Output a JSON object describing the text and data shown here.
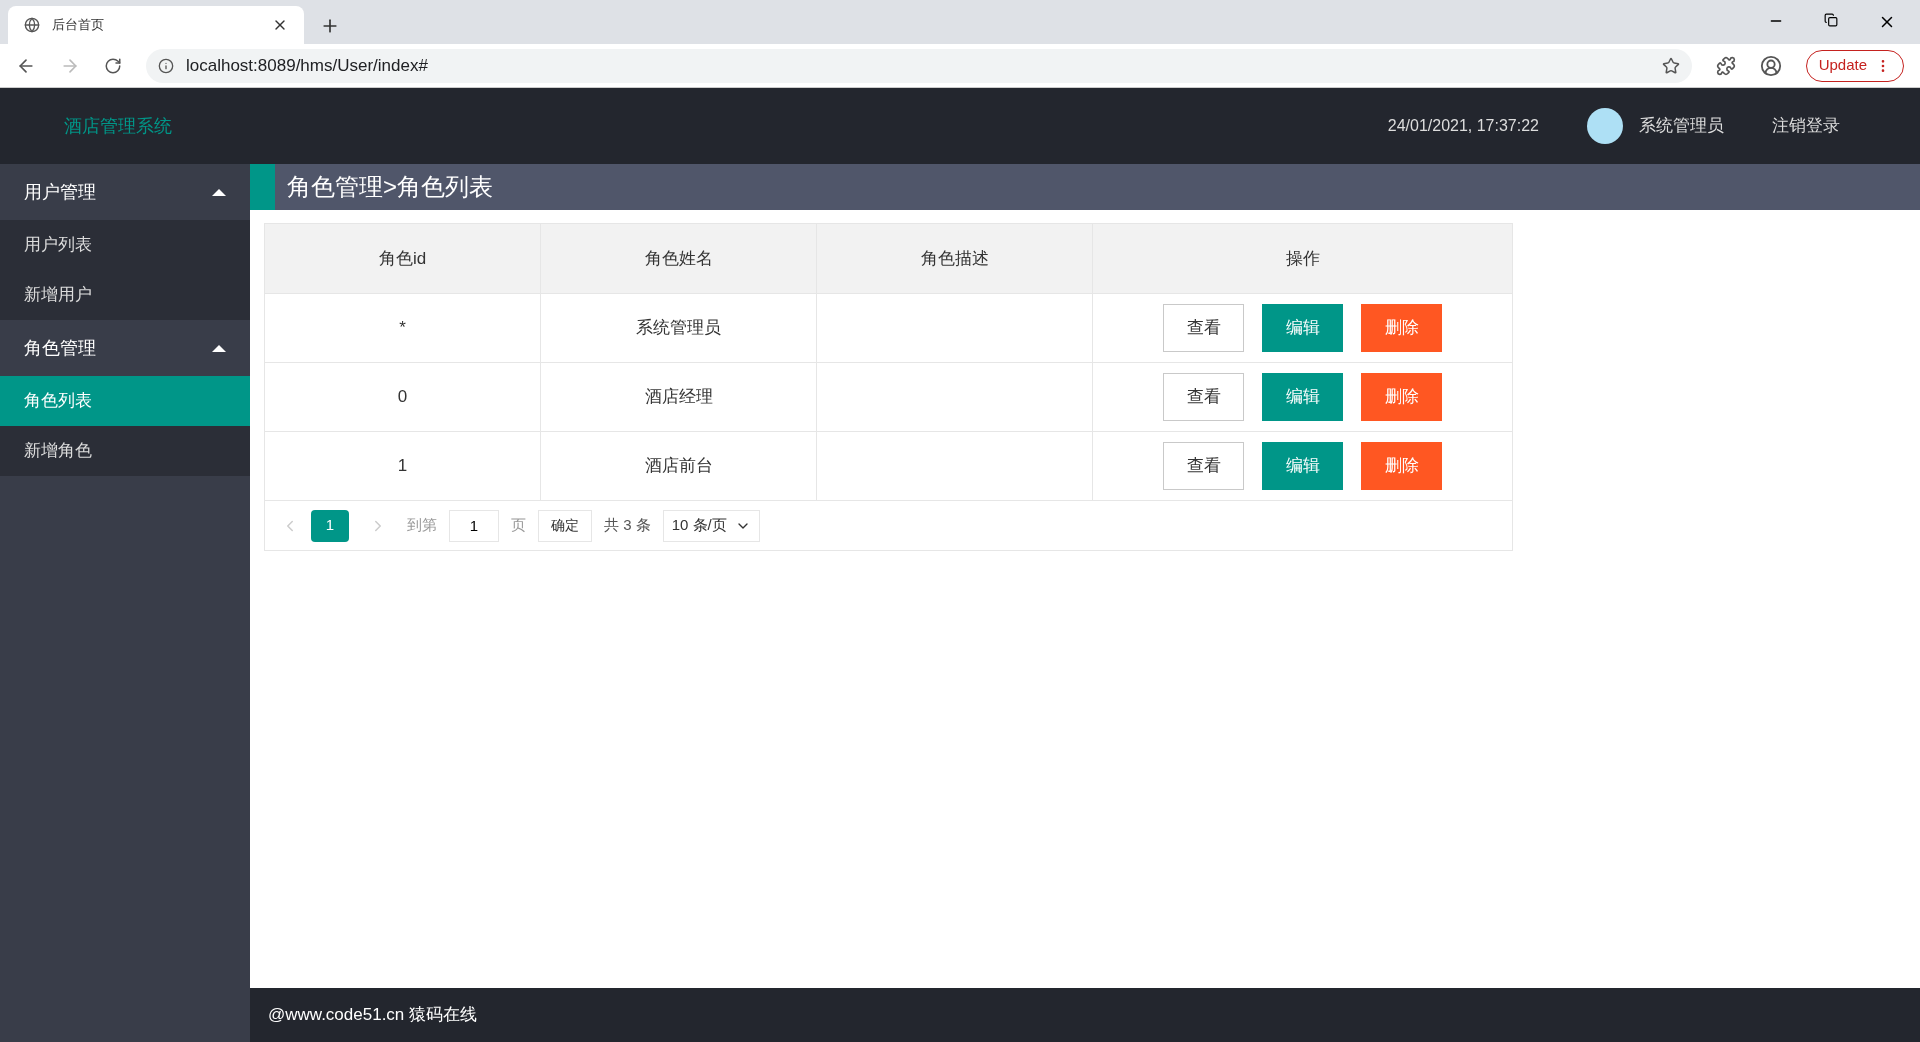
{
  "browser": {
    "tab_title": "后台首页",
    "url": "localhost:8089/hms/User/index#",
    "update_button": "Update"
  },
  "header": {
    "title": "酒店管理系统",
    "datetime": "24/01/2021, 17:37:22",
    "username": "系统管理员",
    "logout": "注销登录"
  },
  "sidebar": {
    "groups": [
      {
        "label": "用户管理",
        "expanded": true,
        "items": [
          {
            "label": "用户列表",
            "selected": false
          },
          {
            "label": "新增用户",
            "selected": false
          }
        ]
      },
      {
        "label": "角色管理",
        "expanded": true,
        "items": [
          {
            "label": "角色列表",
            "selected": true
          },
          {
            "label": "新增角色",
            "selected": false
          }
        ]
      }
    ]
  },
  "breadcrumb": "角色管理>角色列表",
  "table": {
    "columns": [
      "角色id",
      "角色姓名",
      "角色描述",
      "操作"
    ],
    "rows": [
      {
        "cells": [
          "*",
          "系统管理员",
          ""
        ],
        "actions": [
          {
            "label": "查看",
            "kind": "view"
          },
          {
            "label": "编辑",
            "kind": "edit"
          },
          {
            "label": "删除",
            "kind": "delete"
          }
        ]
      },
      {
        "cells": [
          "0",
          "酒店经理",
          ""
        ],
        "actions": [
          {
            "label": "查看",
            "kind": "view"
          },
          {
            "label": "编辑",
            "kind": "edit"
          },
          {
            "label": "删除",
            "kind": "delete"
          }
        ]
      },
      {
        "cells": [
          "1",
          "酒店前台",
          ""
        ],
        "actions": [
          {
            "label": "查看",
            "kind": "view"
          },
          {
            "label": "编辑",
            "kind": "edit"
          },
          {
            "label": "删除",
            "kind": "delete"
          }
        ]
      }
    ]
  },
  "pagination": {
    "pages": [
      {
        "label": "1",
        "selected": true
      }
    ],
    "goto_label": "到第",
    "page_input": "1",
    "page_unit": "页",
    "confirm": "确定",
    "total": "共 3 条",
    "page_size": "10 条/页"
  },
  "footer": "@www.code51.cn 猿码在线"
}
